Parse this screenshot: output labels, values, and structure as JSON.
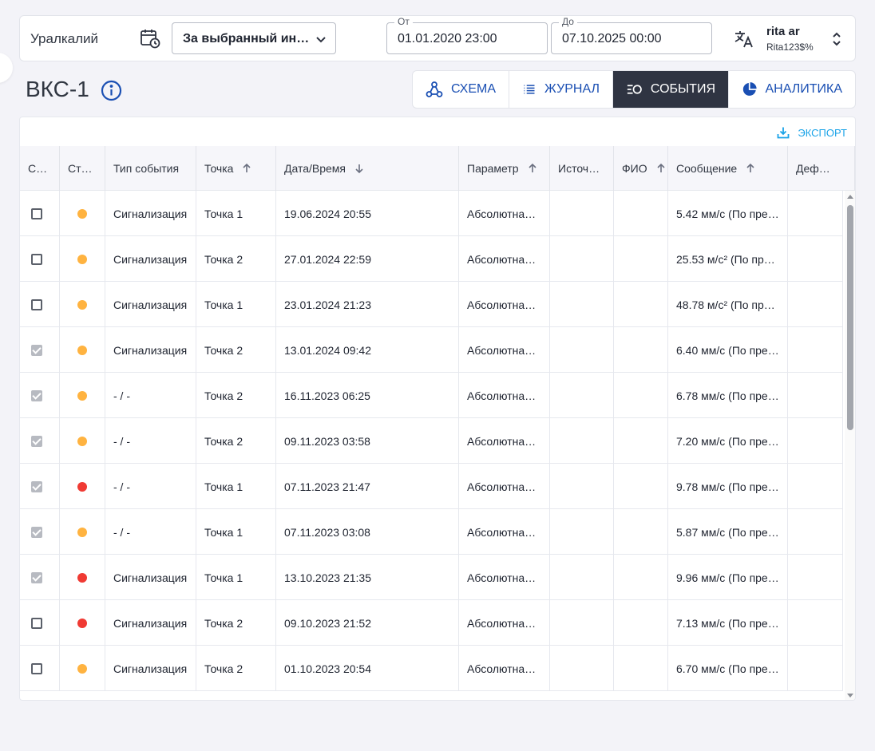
{
  "header": {
    "company": "Уралкалий",
    "period": "За выбранный интервал",
    "from_label": "От",
    "from_value": "01.01.2020 23:00",
    "to_label": "До",
    "to_value": "07.10.2025 00:00",
    "user_name": "rita ar",
    "user_login": "Rita123$%"
  },
  "page": {
    "title": "ВКС-1",
    "tabs": [
      {
        "label": "СХЕМА",
        "icon": "schema-icon"
      },
      {
        "label": "ЖУРНАЛ",
        "icon": "list-icon"
      },
      {
        "label": "СОБЫТИЯ",
        "icon": "events-icon",
        "active": true
      },
      {
        "label": "АНАЛИТИКА",
        "icon": "pie-chart-icon"
      }
    ],
    "export_label": "ЭКСПОРТ"
  },
  "table": {
    "columns": [
      "С…",
      "Ст…",
      "Тип события",
      "Точка",
      "Дата/Время",
      "Параметр",
      "Источ…",
      "ФИО",
      "Сообщение",
      "Деф…"
    ],
    "rows": [
      {
        "checked": false,
        "status": "warning",
        "type": "Сигнализация",
        "point": "Точка 1",
        "datetime": "19.06.2024 20:55",
        "param": "Абсолютна…",
        "source": "",
        "fio": "",
        "message": "5.42 мм/с (По пре…",
        "defect": ""
      },
      {
        "checked": false,
        "status": "warning",
        "type": "Сигнализация",
        "point": "Точка 2",
        "datetime": "27.01.2024 22:59",
        "param": "Абсолютна…",
        "source": "",
        "fio": "",
        "message": "25.53 м/с² (По пр…",
        "defect": ""
      },
      {
        "checked": false,
        "status": "warning",
        "type": "Сигнализация",
        "point": "Точка 1",
        "datetime": "23.01.2024 21:23",
        "param": "Абсолютна…",
        "source": "",
        "fio": "",
        "message": "48.78 м/с² (По пр…",
        "defect": ""
      },
      {
        "checked": true,
        "status": "warning",
        "type": "Сигнализация",
        "point": "Точка 2",
        "datetime": "13.01.2024 09:42",
        "param": "Абсолютна…",
        "source": "",
        "fio": "",
        "message": "6.40 мм/с (По пре…",
        "defect": ""
      },
      {
        "checked": true,
        "status": "warning",
        "type": "- / -",
        "point": "Точка 2",
        "datetime": "16.11.2023 06:25",
        "param": "Абсолютна…",
        "source": "",
        "fio": "",
        "message": "6.78 мм/с (По пре…",
        "defect": ""
      },
      {
        "checked": true,
        "status": "warning",
        "type": "- / -",
        "point": "Точка 2",
        "datetime": "09.11.2023 03:58",
        "param": "Абсолютна…",
        "source": "",
        "fio": "",
        "message": "7.20 мм/с (По пре…",
        "defect": ""
      },
      {
        "checked": true,
        "status": "danger",
        "type": "- / -",
        "point": "Точка 1",
        "datetime": "07.11.2023 21:47",
        "param": "Абсолютна…",
        "source": "",
        "fio": "",
        "message": "9.78 мм/с (По пре…",
        "defect": ""
      },
      {
        "checked": true,
        "status": "warning",
        "type": "- / -",
        "point": "Точка 1",
        "datetime": "07.11.2023 03:08",
        "param": "Абсолютна…",
        "source": "",
        "fio": "",
        "message": "5.87 мм/с (По пре…",
        "defect": ""
      },
      {
        "checked": true,
        "status": "danger",
        "type": "Сигнализация",
        "point": "Точка 1",
        "datetime": "13.10.2023 21:35",
        "param": "Абсолютна…",
        "source": "",
        "fio": "",
        "message": "9.96 мм/с (По пре…",
        "defect": ""
      },
      {
        "checked": false,
        "status": "danger",
        "type": "Сигнализация",
        "point": "Точка 2",
        "datetime": "09.10.2023 21:52",
        "param": "Абсолютна…",
        "source": "",
        "fio": "",
        "message": "7.13 мм/с (По пре…",
        "defect": ""
      },
      {
        "checked": false,
        "status": "warning",
        "type": "Сигнализация",
        "point": "Точка 2",
        "datetime": "01.10.2023 20:54",
        "param": "Абсолютна…",
        "source": "",
        "fio": "",
        "message": "6.70 мм/с (По пре…",
        "defect": ""
      }
    ]
  },
  "colors": {
    "warning": "#ffb340",
    "danger": "#f03a33",
    "accent": "#1a4fb3",
    "active_tab": "#2f3442",
    "export": "#1aa3e8"
  }
}
